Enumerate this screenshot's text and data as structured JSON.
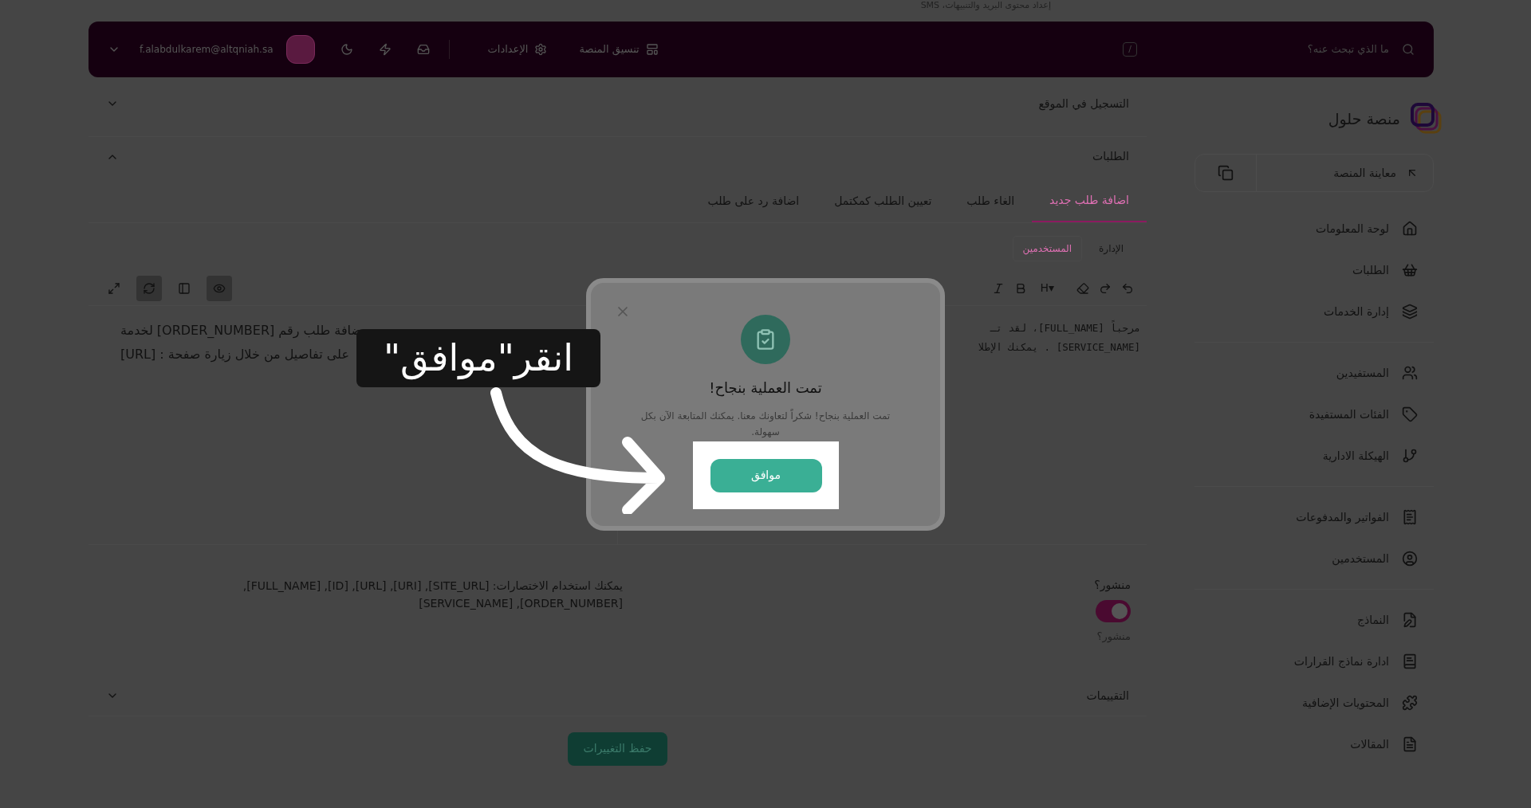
{
  "page_hint": "إعداد محتوى البريد والتنبيهات، SMS",
  "topbar": {
    "search_placeholder": "ما الذي تبحث عنه؟",
    "shortcut": "/",
    "links": [
      "تنسيق المنصة",
      "الإعدادات"
    ],
    "email": "f.alabdulkarem@altqniah.sa"
  },
  "sidebar": {
    "brand": "منصة حلول",
    "preview": "معاينة المنصة",
    "groups": [
      [
        "لوحة المعلومات",
        "الطلبات",
        "إدارة الخدمات"
      ],
      [
        "المستفيدين",
        "الفئات المستفيدة",
        "الهيكلة الادارية"
      ],
      [
        "الفواتير والمدفوعات",
        "المستخدمين"
      ],
      [
        "النماذج",
        "ادارة نماذج القرارات",
        "المحتويات الإضافية",
        "المقالات"
      ]
    ]
  },
  "sections": [
    {
      "title": "التسجيل في الموقع",
      "expanded": false
    },
    {
      "title": "الطلبات",
      "expanded": true
    }
  ],
  "tabs": [
    {
      "label": "اضافة طلب جديد",
      "selected": true
    },
    {
      "label": "الغاء طلب",
      "selected": false
    },
    {
      "label": "تعيين الطلب كمكتمل",
      "selected": false
    },
    {
      "label": "اضافة رد على طلب",
      "selected": false
    }
  ],
  "audience": [
    {
      "label": "الإدارة",
      "selected": false
    },
    {
      "label": "المستخدمين",
      "selected": true
    }
  ],
  "editor": {
    "tools_right": [
      "H▾"
    ],
    "view_tools": [
      {
        "active": true
      },
      {
        "active": false
      },
      {
        "active": true
      },
      {
        "active": false
      }
    ],
    "source_lines": [
      "مرحباً [FULL_NAME]، لقد تـ",
      "[SERVICE_NAME] . يمكنك الإطلا"
    ],
    "preview_lines": [
      "ضافة طلب رقم [ORDER_NUMBER] لخدمة",
      "على تفاصيل من خلال زيارة صفحة : [URL]"
    ]
  },
  "published": {
    "label": "منشور؟",
    "on": true,
    "hint": "منشور؟"
  },
  "shortcuts_note": "يمكنك استخدام الاختصارات: [SITE_URL], [URI], [URL], [ID], [FULL_NAME], [ORDER_NUMBER], [SERVICE_NAME]",
  "ratings": {
    "title": "التقييمات",
    "expanded": false
  },
  "save_button": "حفظ التغييرات",
  "modal": {
    "title": "تمت العملية بنجاح!",
    "message": "تمت العملية بنجاح! شكراً لتعاونك معنا. يمكنك المتابعة الآن بكل سهولة.",
    "confirm": "موافق"
  },
  "callout": "انقر\"موافق\""
}
